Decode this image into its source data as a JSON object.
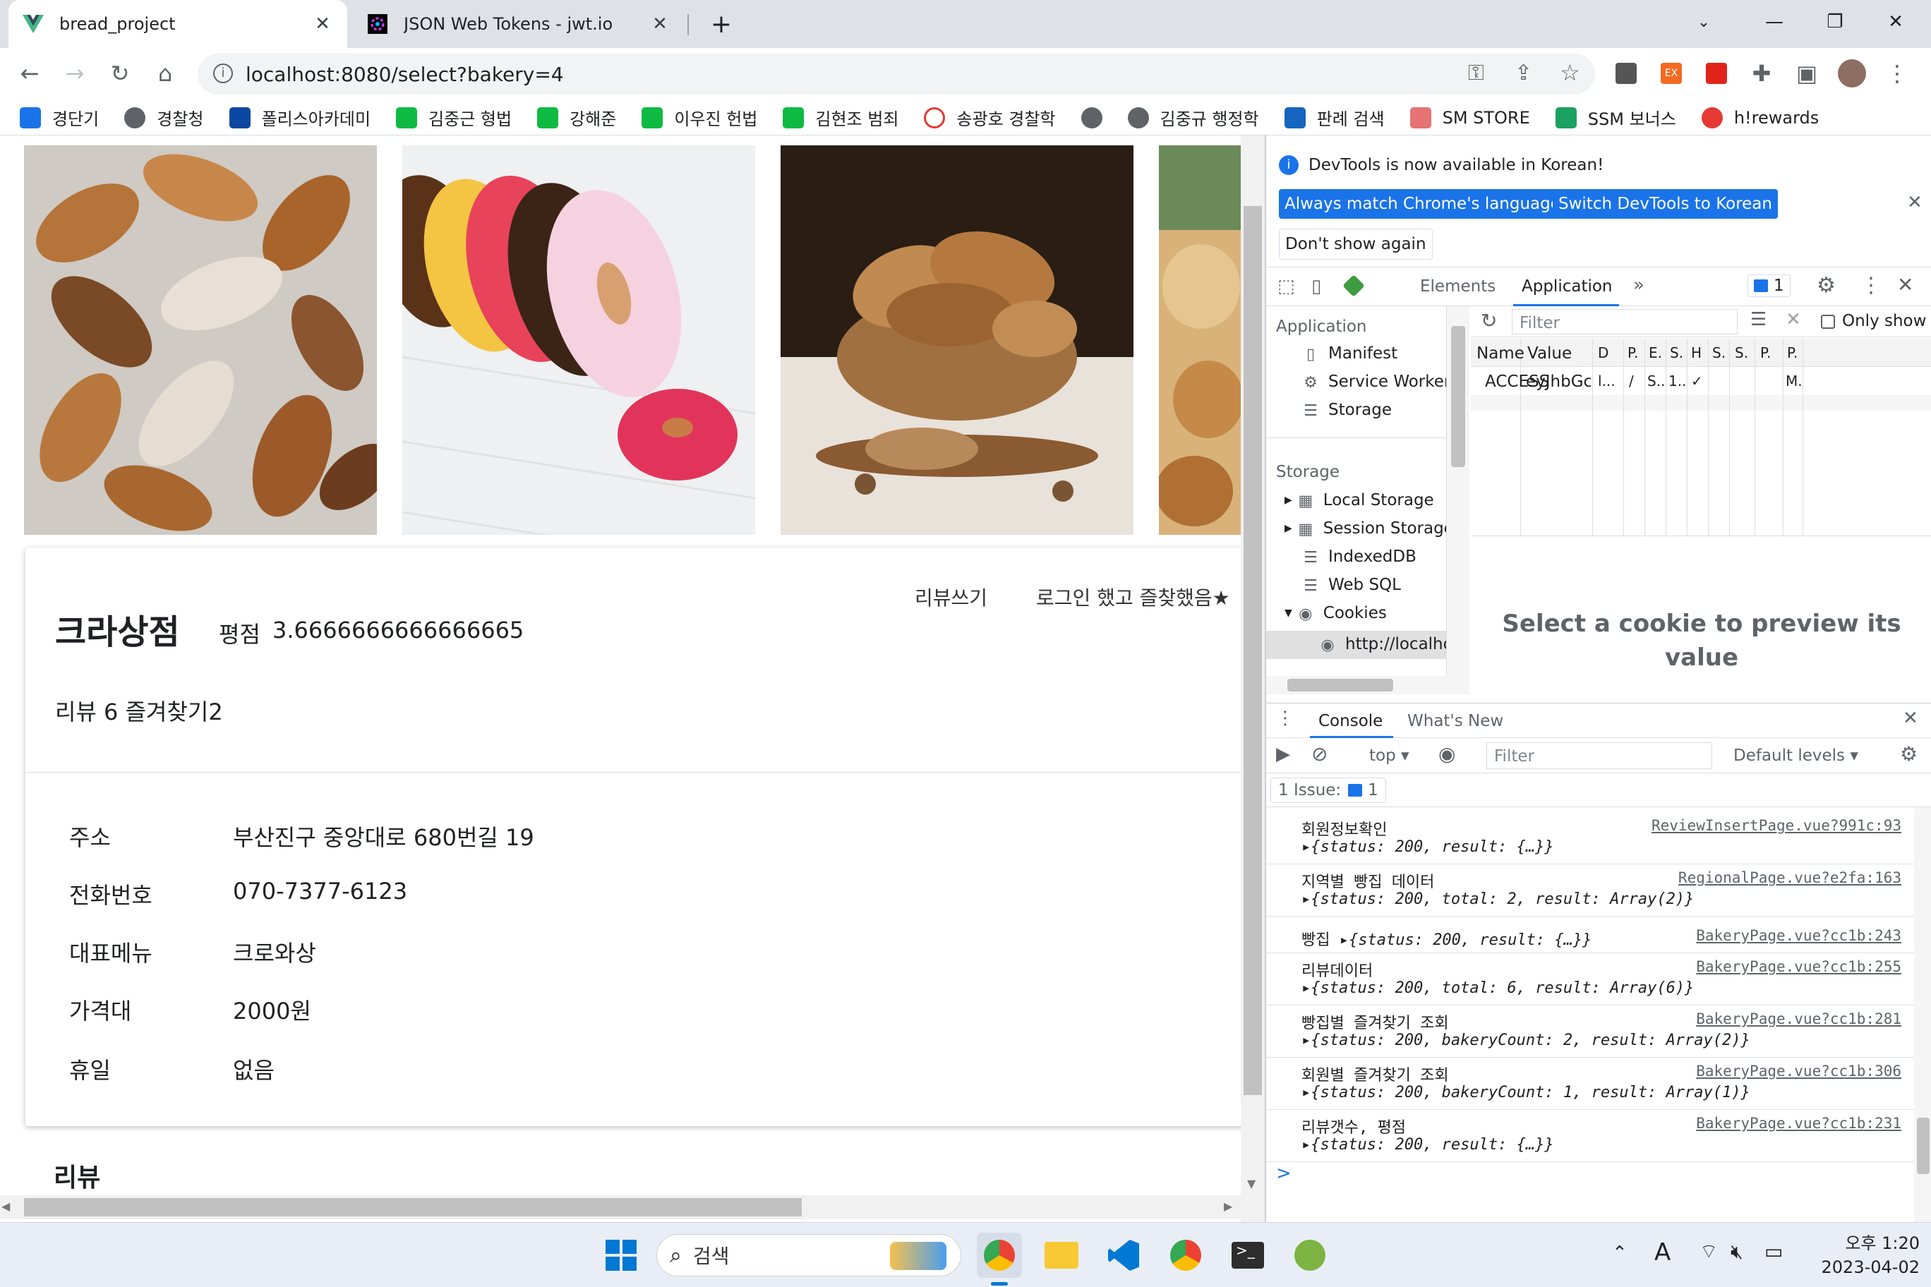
{
  "browser": {
    "tabs": [
      {
        "title": "bread_project",
        "icon": "vue-logo-icon",
        "active": true
      },
      {
        "title": "JSON Web Tokens - jwt.io",
        "icon": "jwt-logo-icon",
        "active": false
      }
    ],
    "new_tab": "+",
    "url": "localhost:8080/select?bakery=4",
    "bookmarks": [
      {
        "label": "경단기",
        "color": "#1a73e8"
      },
      {
        "label": "경찰청",
        "color": "#5f6368"
      },
      {
        "label": "폴리스아카데미",
        "color": "#0d47a1"
      },
      {
        "label": "김중근 형법",
        "color": "#0fba43"
      },
      {
        "label": "강해준",
        "color": "#0fba43"
      },
      {
        "label": "이우진 헌법",
        "color": "#0fba43"
      },
      {
        "label": "김현조 범죄",
        "color": "#0fba43"
      },
      {
        "label": "송광호 경찰학",
        "color": "#e53935"
      },
      {
        "label": "",
        "color": "#5f6368"
      },
      {
        "label": "김중규 행정학",
        "color": "#5f6368"
      },
      {
        "label": "판례 검색",
        "color": "#1565c0"
      },
      {
        "label": "SM STORE",
        "color": "#e57373"
      },
      {
        "label": "SSM 보너스",
        "color": "#1aa260"
      },
      {
        "label": "h!rewards",
        "color": "#e53935"
      }
    ]
  },
  "bakery": {
    "name": "크라상점",
    "rating_label": "평점",
    "rating_value": "3.6666666666666665",
    "write_review": "리뷰쓰기",
    "favorite_text": "로그인 했고 즐찾했음★",
    "stats": "리뷰 6 즐겨찾기2",
    "details": [
      {
        "label": "주소",
        "value": "부산진구 중앙대로 680번길 19"
      },
      {
        "label": "전화번호",
        "value": "070-7377-6123"
      },
      {
        "label": "대표메뉴",
        "value": "크로와상"
      },
      {
        "label": "가격대",
        "value": "2000원"
      },
      {
        "label": "휴일",
        "value": "없음"
      }
    ],
    "review_heading": "리뷰"
  },
  "devtools": {
    "banner": "DevTools is now available in Korean!",
    "btn_match": "Always match Chrome's language",
    "btn_switch": "Switch DevTools to Korean",
    "btn_dont": "Don't show again",
    "tabs": {
      "elements": "Elements",
      "application": "Application",
      "more": "»",
      "issues_count": "1"
    },
    "sidebar": {
      "app_header": "Application",
      "manifest": "Manifest",
      "service_workers": "Service Workers",
      "storage_item": "Storage",
      "storage_header": "Storage",
      "local_storage": "Local Storage",
      "session_storage": "Session Storage",
      "indexeddb": "IndexedDB",
      "websql": "Web SQL",
      "cookies": "Cookies",
      "cookie_host": "http://localho"
    },
    "cookies": {
      "filter_placeholder": "Filter",
      "only_show": "Only show c...",
      "columns": [
        "Name",
        "Value",
        "D",
        "P.",
        "E.",
        "S.",
        "H",
        "S.",
        "S.",
        "P.",
        "P."
      ],
      "row": [
        "ACCESS",
        "eyJhbGciOiJI...",
        "l...",
        "/",
        "S..",
        "1..",
        "✓",
        "",
        "",
        "",
        "M."
      ],
      "preview": "Select a cookie to preview its value"
    },
    "drawer": {
      "console_tab": "Console",
      "whats_new_tab": "What's New",
      "context": "top",
      "filter_placeholder": "Filter",
      "levels": "Default levels",
      "issues": "1 Issue:",
      "issues_count": "1"
    },
    "console_lines": [
      {
        "label": "회원정보확인",
        "source": "ReviewInsertPage.vue?991c:93",
        "obj": "{status: 200, result: {…}}"
      },
      {
        "label": "지역별 빵집 데이터",
        "source": "RegionalPage.vue?e2fa:163",
        "obj": "{status: 200, total: 2, result: Array(2)}"
      },
      {
        "label": "빵집",
        "source": "BakeryPage.vue?cc1b:243",
        "obj": "{status: 200, result: {…}}"
      },
      {
        "label": "리뷰데이터",
        "source": "BakeryPage.vue?cc1b:255",
        "obj": "{status: 200, total: 6, result: Array(6)}"
      },
      {
        "label": "빵집별 즐겨찾기 조회",
        "source": "BakeryPage.vue?cc1b:281",
        "obj": "{status: 200, bakeryCount: 2, result: Array(2)}"
      },
      {
        "label": "회원별 즐겨찾기 조회",
        "source": "BakeryPage.vue?cc1b:306",
        "obj": "{status: 200, bakeryCount: 1, result: Array(1)}"
      },
      {
        "label": "리뷰갯수, 평점",
        "source": "BakeryPage.vue?cc1b:231",
        "obj": "{status: 200, result: {…}}"
      }
    ],
    "prompt": ">"
  },
  "taskbar": {
    "search": "검색",
    "time": "오후 1:20",
    "date": "2023-04-02",
    "ime": "A"
  }
}
